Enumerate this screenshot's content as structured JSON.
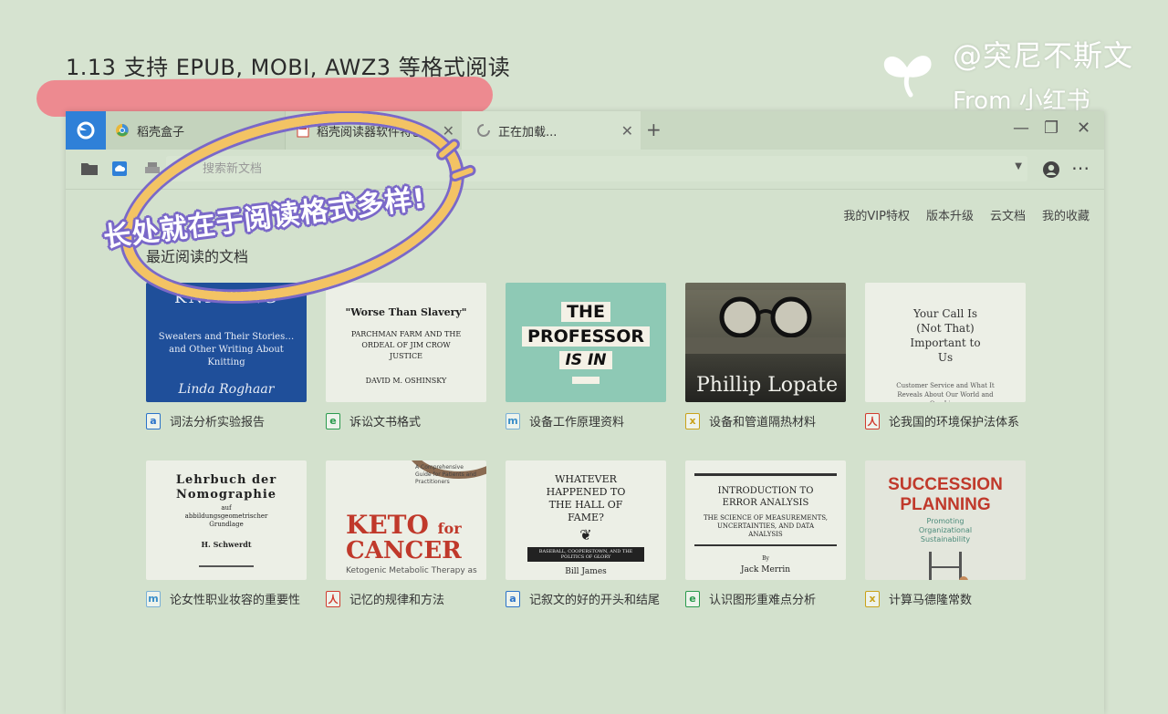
{
  "slide": {
    "title": "1.13 支持 EPUB, MOBI, AWZ3 等格式阅读",
    "annotation": "长处就在于阅读格式多样!"
  },
  "watermark": {
    "line1": "@突尼不斯文",
    "line2": "From 小红书"
  },
  "tabs": [
    {
      "label": "稻壳盒子",
      "icon": "chrome-icon"
    },
    {
      "label": "稻壳阅读器软件特色",
      "icon": "pdf-doc-icon"
    },
    {
      "label": "正在加载...",
      "icon": "loading-icon"
    }
  ],
  "toolbar": {
    "search_placeholder": "搜索新文档"
  },
  "quicklinks": [
    "我的VIP特权",
    "版本升级",
    "云文档",
    "我的收藏"
  ],
  "section_title": "最近阅读的文档",
  "documents": [
    {
      "label": "词法分析实验报告",
      "type": "word",
      "type_glyph": "a",
      "cover": {
        "title": "KNITTING",
        "subtitle": "Sweaters and Their Stories…and Other Writing About Knitting",
        "author": "Linda Roghaar"
      }
    },
    {
      "label": "诉讼文书格式",
      "type": "epub",
      "type_glyph": "e",
      "cover": {
        "title": "\"Worse Than Slavery\"",
        "subtitle": "PARCHMAN FARM AND THE ORDEAL OF JIM CROW JUSTICE",
        "author": "DAVID M. OSHINSKY"
      }
    },
    {
      "label": "设备工作原理资料",
      "type": "mobi",
      "type_glyph": "m",
      "cover": {
        "line1": "THE",
        "line2": "PROFESSOR",
        "line3": "IS IN"
      }
    },
    {
      "label": "设备和管道隔热材料",
      "type": "azw3",
      "type_glyph": "x",
      "cover": {
        "author": "Phillip Lopate"
      }
    },
    {
      "label": "论我国的环境保护法体系",
      "type": "pdf",
      "type_glyph": "人",
      "cover": {
        "title": "Your Call Is (Not That) Important to Us",
        "subtitle": "Customer Service and What It Reveals About Our World and Our Lives"
      }
    },
    {
      "label": "论女性职业妆容的重要性",
      "type": "mobi",
      "type_glyph": "m",
      "cover": {
        "title": "Lehrbuch der Nomographie",
        "subtitle": "auf abbildungsgeometrischer Grundlage",
        "author": "H. Schwerdt"
      }
    },
    {
      "label": "记忆的规律和方法",
      "type": "pdf",
      "type_glyph": "人",
      "cover": {
        "tag": "A Comprehensive Guide for Patients and Practitioners",
        "line1": "KETO",
        "line1b": "for",
        "line2": "CANCER",
        "subtitle": "Ketogenic Metabolic Therapy as"
      }
    },
    {
      "label": "记叙文的好的开头和结尾",
      "type": "word",
      "type_glyph": "a",
      "cover": {
        "title": "WHATEVER HAPPENED TO THE HALL OF FAME?",
        "band": "BASEBALL, COOPERSTOWN, AND THE POLITICS OF GLORY",
        "author": "Bill James"
      }
    },
    {
      "label": "认识图形重难点分析",
      "type": "epub",
      "type_glyph": "e",
      "cover": {
        "title": "INTRODUCTION TO ERROR ANALYSIS",
        "subtitle": "THE SCIENCE OF MEASUREMENTS, UNCERTAINTIES, AND DATA ANALYSIS",
        "by": "By",
        "author": "Jack Merrin"
      }
    },
    {
      "label": "计算马德隆常数",
      "type": "azw3",
      "type_glyph": "x",
      "cover": {
        "line1": "SUCCESSION",
        "line2": "PLANNING",
        "subtitle": "Promoting Organizational Sustainability"
      }
    }
  ]
}
